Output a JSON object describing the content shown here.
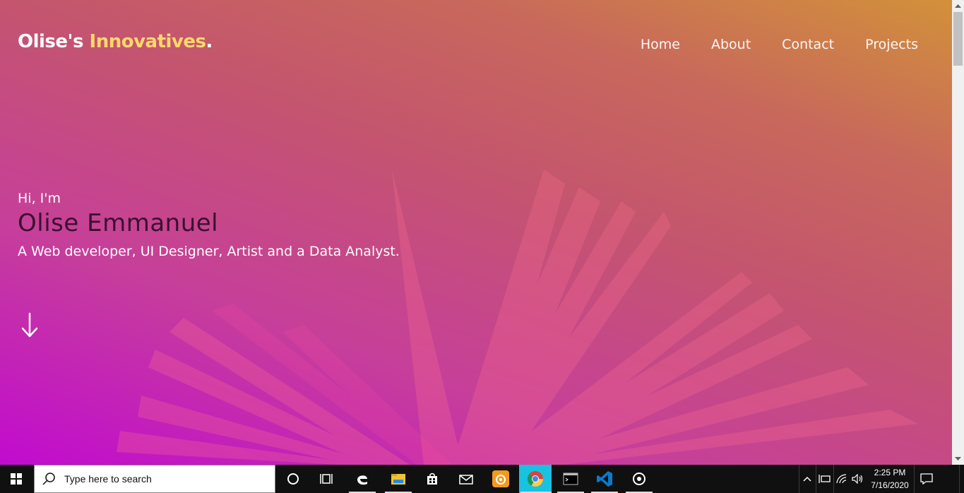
{
  "page": {
    "logo": {
      "main": "Olise's ",
      "accent": "Innovatives",
      "dot": "."
    },
    "nav": [
      "Home",
      "About",
      "Contact",
      "Projects"
    ],
    "hero": {
      "greeting": "Hi, I'm",
      "name": "Olise Emmanuel",
      "tagline": "A Web developer, UI Designer, Artist and a Data Analyst."
    },
    "scroll_icon": "arrow-down-icon"
  },
  "taskbar": {
    "search_placeholder": "Type here to search",
    "time": "2:25 PM",
    "date": "7/16/2020",
    "apps": [
      "windows-start-icon",
      "search-icon",
      "cortana-icon",
      "task-view-icon",
      "edge-icon",
      "file-explorer-icon",
      "store-icon",
      "mail-icon",
      "uc-browser-icon",
      "chrome-icon",
      "terminal-icon",
      "vscode-icon",
      "media-icon"
    ],
    "tray": [
      "chevron-up-icon",
      "network-device-icon",
      "wifi-icon",
      "volume-icon",
      "notification-icon"
    ]
  },
  "colors": {
    "accent": "#ffd86a",
    "name": "#3a1030",
    "gradient_start": "#c10bcf",
    "gradient_end": "#d2913a"
  }
}
